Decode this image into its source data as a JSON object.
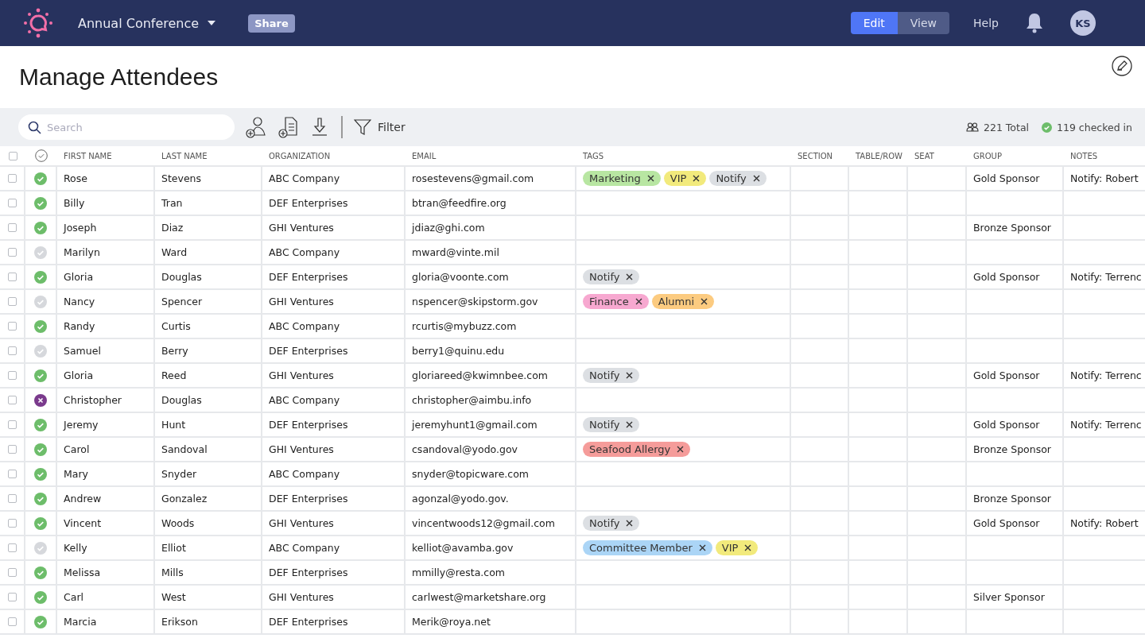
{
  "topbar": {
    "event_title": "Annual Conference",
    "share": "Share",
    "modes": [
      {
        "label": "Edit",
        "selected": true
      },
      {
        "label": "View",
        "selected": false
      }
    ],
    "help": "Help",
    "avatar": "KS"
  },
  "page_title": "Manage Attendees",
  "toolbar": {
    "search_placeholder": "Search",
    "filter": "Filter",
    "total": "221 Total",
    "checked_in": "119 checked in"
  },
  "table": {
    "select_all_checked": false,
    "columns": [
      "FIRST NAME",
      "LAST NAME",
      "ORGANIZATION",
      "EMAIL",
      "TAGS",
      "SECTION",
      "TABLE/ROW",
      "SEAT",
      "GROUP",
      "NOTES"
    ],
    "rows": [
      {
        "checked": false,
        "kind": "in",
        "first": "Rose",
        "last": "Stevens",
        "org": "ABC Company",
        "email": "rosestevens@gmail.com",
        "tags": [
          {
            "label": "Marketing",
            "color": "#b8e6a2"
          },
          {
            "label": "VIP",
            "color": "#f2ea7c"
          },
          {
            "label": "Notify",
            "color": "#dcdfe3"
          }
        ],
        "group": "Gold Sponsor",
        "notes": "Notify: Robert"
      },
      {
        "checked": false,
        "kind": "in",
        "first": "Billy",
        "last": "Tran",
        "org": "DEF Enterprises",
        "email": "btran@feedfire.org"
      },
      {
        "checked": false,
        "kind": "in",
        "first": "Joseph",
        "last": "Diaz",
        "org": "GHI Ventures",
        "email": "jdiaz@ghi.com",
        "group": "Bronze Sponsor"
      },
      {
        "checked": false,
        "kind": "out",
        "first": "Marilyn",
        "last": "Ward",
        "org": "ABC Company",
        "email": "mward@vinte.mil"
      },
      {
        "checked": false,
        "kind": "in",
        "first": "Gloria",
        "last": "Douglas",
        "org": "DEF Enterprises",
        "email": "gloria@voonte.com",
        "tags": [
          {
            "label": "Notify",
            "color": "#dcdfe3"
          }
        ],
        "group": "Gold Sponsor",
        "notes": "Notify: Terrenc"
      },
      {
        "checked": false,
        "kind": "out",
        "first": "Nancy",
        "last": "Spencer",
        "org": "GHI Ventures",
        "email": "nspencer@skipstorm.gov",
        "tags": [
          {
            "label": "Finance",
            "color": "#f7a8d0"
          },
          {
            "label": "Alumni",
            "color": "#fccb80"
          }
        ]
      },
      {
        "checked": false,
        "kind": "in",
        "first": "Randy",
        "last": "Curtis",
        "org": "ABC Company",
        "email": "rcurtis@mybuzz.com"
      },
      {
        "checked": false,
        "kind": "out",
        "first": "Samuel",
        "last": "Berry",
        "org": "DEF Enterprises",
        "email": "berry1@quinu.edu"
      },
      {
        "checked": false,
        "kind": "in",
        "first": "Gloria",
        "last": "Reed",
        "org": "GHI Ventures",
        "email": "gloriareed@kwimnbee.com",
        "tags": [
          {
            "label": "Notify",
            "color": "#dcdfe3"
          }
        ],
        "group": "Gold Sponsor",
        "notes": "Notify: Terrenc"
      },
      {
        "checked": false,
        "kind": "cancelled",
        "first": "Christopher",
        "last": "Douglas",
        "org": "ABC Company",
        "email": "christopher@aimbu.info"
      },
      {
        "checked": false,
        "kind": "in",
        "first": "Jeremy",
        "last": "Hunt",
        "org": "DEF Enterprises",
        "email": "jeremyhunt1@gmail.com",
        "tags": [
          {
            "label": "Notify",
            "color": "#dcdfe3"
          }
        ],
        "group": "Gold Sponsor",
        "notes": "Notify: Terrenc"
      },
      {
        "checked": false,
        "kind": "in",
        "first": "Carol",
        "last": "Sandoval",
        "org": "GHI Ventures",
        "email": "csandoval@yodo.gov",
        "tags": [
          {
            "label": "Seafood Allergy",
            "color": "#f59c9a"
          }
        ],
        "group": "Bronze Sponsor"
      },
      {
        "checked": false,
        "kind": "in",
        "first": "Mary",
        "last": "Snyder",
        "org": "ABC Company",
        "email": "snyder@topicware.com"
      },
      {
        "checked": false,
        "kind": "in",
        "first": "Andrew",
        "last": "Gonzalez",
        "org": "DEF Enterprises",
        "email": "agonzal@yodo.gov.",
        "group": "Bronze Sponsor"
      },
      {
        "checked": false,
        "kind": "in",
        "first": "Vincent",
        "last": "Woods",
        "org": "GHI Ventures",
        "email": "vincentwoods12@gmail.com",
        "tags": [
          {
            "label": "Notify",
            "color": "#dcdfe3"
          }
        ],
        "group": "Gold Sponsor",
        "notes": "Notify: Robert"
      },
      {
        "checked": false,
        "kind": "out",
        "first": "Kelly",
        "last": "Elliot",
        "org": "ABC Company",
        "email": "kelliot@avamba.gov",
        "tags": [
          {
            "label": "Committee Member",
            "color": "#abd5f6"
          },
          {
            "label": "VIP",
            "color": "#f2ea7c"
          }
        ]
      },
      {
        "checked": false,
        "kind": "in",
        "first": "Melissa",
        "last": "Mills",
        "org": "DEF Enterprises",
        "email": "mmilly@resta.com"
      },
      {
        "checked": false,
        "kind": "in",
        "first": "Carl",
        "last": "West",
        "org": "GHI Ventures",
        "email": "carlwest@marketshare.org",
        "group": "Silver Sponsor"
      },
      {
        "checked": false,
        "kind": "in",
        "first": "Marcia",
        "last": "Erikson",
        "org": "DEF Enterprises",
        "email": "Merik@roya.net"
      }
    ]
  }
}
